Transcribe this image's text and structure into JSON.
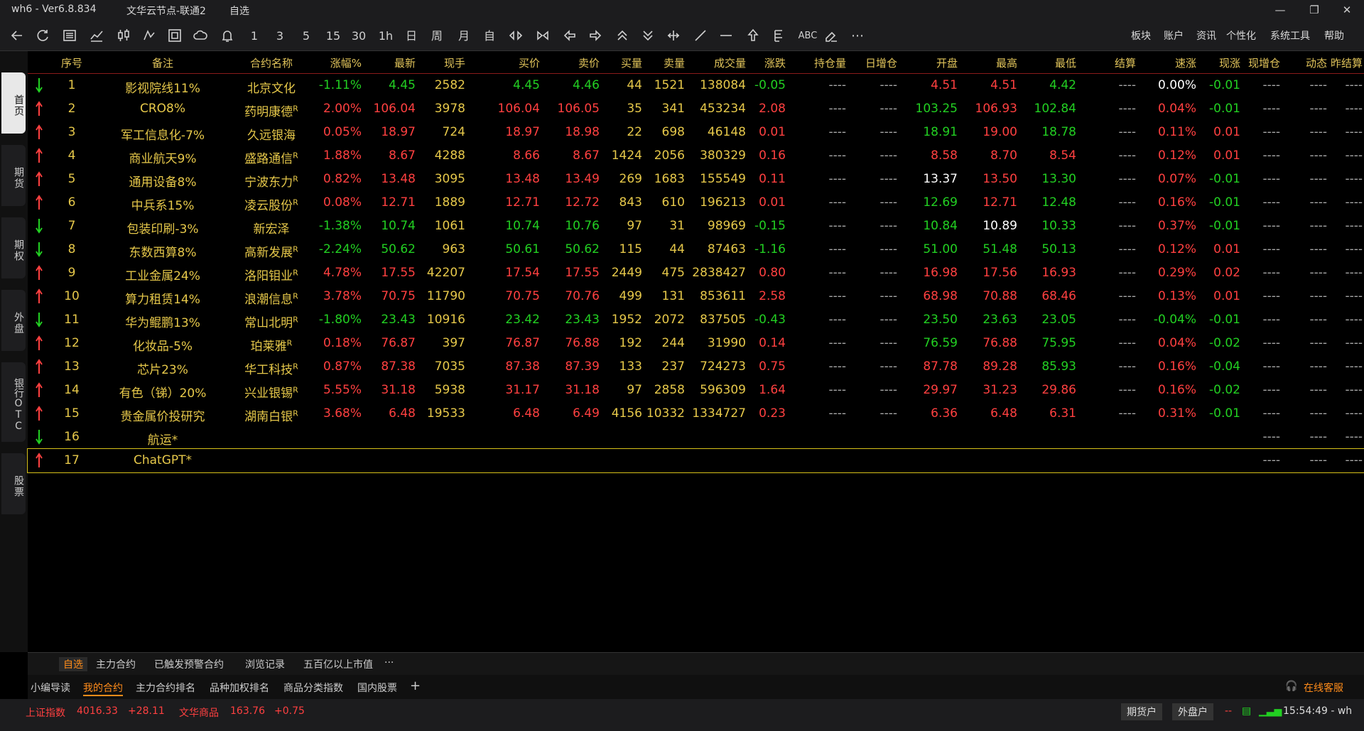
{
  "titlebar": {
    "app": "wh6  -  Ver6.8.834",
    "server": "文华云节点-联通2",
    "view": "自选"
  },
  "toolbar": {
    "buttons": [
      "1",
      "3",
      "5",
      "15",
      "30",
      "1h",
      "日",
      "周",
      "月",
      "自"
    ],
    "menus": [
      "板块",
      "账户",
      "资讯",
      "个性化",
      "系统工具",
      "帮助"
    ],
    "abc": "ABC"
  },
  "sidebar": [
    "首页",
    "期货",
    "期权",
    "外盘",
    "银行OTC",
    "股票"
  ],
  "headers": [
    "序号",
    "备注",
    "合约名称",
    "涨幅%",
    "最新",
    "现手",
    "买价",
    "卖价",
    "买量",
    "卖量",
    "成交量",
    "涨跌",
    "持仓量",
    "日增仓",
    "开盘",
    "最高",
    "最低",
    "结算",
    "速涨",
    "现涨",
    "现增仓",
    "动态",
    "昨结算"
  ],
  "rows": [
    {
      "dir": "down",
      "n": "1",
      "note": "影视院线11%",
      "name": "北京文化",
      "r": "",
      "pct": "-1.11%",
      "last": "4.45",
      "vol1": "2582",
      "bid": "4.45",
      "ask": "4.46",
      "bq": "44",
      "aq": "1521",
      "tot": "138084",
      "chg": "-0.05",
      "oi": "----",
      "doi": "----",
      "open": "4.51",
      "high": "4.51",
      "low": "4.42",
      "settle": "----",
      "speed": "0.00%",
      "cur": "-0.01",
      "cd": "----",
      "dyn": "----",
      "ps": "----",
      "c": {
        "pct": "dn",
        "last": "dn",
        "bid": "dn",
        "ask": "dn",
        "chg": "dn",
        "open": "up",
        "high": "up",
        "low": "dn",
        "speed": "wh",
        "cur": "dn"
      }
    },
    {
      "dir": "up",
      "n": "2",
      "note": "CRO8%",
      "name": "药明康德",
      "r": "R",
      "pct": "2.00%",
      "last": "106.04",
      "vol1": "3978",
      "bid": "106.04",
      "ask": "106.05",
      "bq": "35",
      "aq": "341",
      "tot": "453234",
      "chg": "2.08",
      "oi": "----",
      "doi": "----",
      "open": "103.25",
      "high": "106.93",
      "low": "102.84",
      "settle": "----",
      "speed": "0.04%",
      "cur": "-0.01",
      "cd": "----",
      "dyn": "----",
      "ps": "----",
      "c": {
        "pct": "up",
        "last": "up",
        "bid": "up",
        "ask": "up",
        "chg": "up",
        "open": "dn",
        "high": "up",
        "low": "dn",
        "speed": "up",
        "cur": "dn"
      }
    },
    {
      "dir": "up",
      "n": "3",
      "note": "军工信息化-7%",
      "name": "久远银海",
      "r": "",
      "pct": "0.05%",
      "last": "18.97",
      "vol1": "724",
      "bid": "18.97",
      "ask": "18.98",
      "bq": "22",
      "aq": "698",
      "tot": "46148",
      "chg": "0.01",
      "oi": "----",
      "doi": "----",
      "open": "18.91",
      "high": "19.00",
      "low": "18.78",
      "settle": "----",
      "speed": "0.11%",
      "cur": "0.01",
      "cd": "----",
      "dyn": "----",
      "ps": "----",
      "c": {
        "pct": "up",
        "last": "up",
        "bid": "up",
        "ask": "up",
        "chg": "up",
        "open": "dn",
        "high": "up",
        "low": "dn",
        "speed": "up",
        "cur": "up"
      }
    },
    {
      "dir": "up",
      "n": "4",
      "note": "商业航天9%",
      "name": "盛路通信",
      "r": "R",
      "pct": "1.88%",
      "last": "8.67",
      "vol1": "4288",
      "bid": "8.66",
      "ask": "8.67",
      "bq": "1424",
      "aq": "2056",
      "tot": "380329",
      "chg": "0.16",
      "oi": "----",
      "doi": "----",
      "open": "8.58",
      "high": "8.70",
      "low": "8.54",
      "settle": "----",
      "speed": "0.12%",
      "cur": "0.01",
      "cd": "----",
      "dyn": "----",
      "ps": "----",
      "c": {
        "pct": "up",
        "last": "up",
        "bid": "up",
        "ask": "up",
        "chg": "up",
        "open": "up",
        "high": "up",
        "low": "up",
        "speed": "up",
        "cur": "up"
      }
    },
    {
      "dir": "up",
      "n": "5",
      "note": "通用设备8%",
      "name": "宁波东力",
      "r": "R",
      "pct": "0.82%",
      "last": "13.48",
      "vol1": "3095",
      "bid": "13.48",
      "ask": "13.49",
      "bq": "269",
      "aq": "1683",
      "tot": "155549",
      "chg": "0.11",
      "oi": "----",
      "doi": "----",
      "open": "13.37",
      "high": "13.50",
      "low": "13.30",
      "settle": "----",
      "speed": "0.07%",
      "cur": "-0.01",
      "cd": "----",
      "dyn": "----",
      "ps": "----",
      "c": {
        "pct": "up",
        "last": "up",
        "bid": "up",
        "ask": "up",
        "chg": "up",
        "open": "wh",
        "high": "up",
        "low": "dn",
        "speed": "up",
        "cur": "dn"
      }
    },
    {
      "dir": "up",
      "n": "6",
      "note": "中兵系15%",
      "name": "凌云股份",
      "r": "R",
      "pct": "0.08%",
      "last": "12.71",
      "vol1": "1889",
      "bid": "12.71",
      "ask": "12.72",
      "bq": "843",
      "aq": "610",
      "tot": "196213",
      "chg": "0.01",
      "oi": "----",
      "doi": "----",
      "open": "12.69",
      "high": "12.71",
      "low": "12.48",
      "settle": "----",
      "speed": "0.16%",
      "cur": "-0.01",
      "cd": "----",
      "dyn": "----",
      "ps": "----",
      "c": {
        "pct": "up",
        "last": "up",
        "bid": "up",
        "ask": "up",
        "chg": "up",
        "open": "dn",
        "high": "up",
        "low": "dn",
        "speed": "up",
        "cur": "dn"
      }
    },
    {
      "dir": "down",
      "n": "7",
      "note": "包装印刷-3%",
      "name": "新宏泽",
      "r": "",
      "pct": "-1.38%",
      "last": "10.74",
      "vol1": "1061",
      "bid": "10.74",
      "ask": "10.76",
      "bq": "97",
      "aq": "31",
      "tot": "98969",
      "chg": "-0.15",
      "oi": "----",
      "doi": "----",
      "open": "10.84",
      "high": "10.89",
      "low": "10.33",
      "settle": "----",
      "speed": "0.37%",
      "cur": "-0.01",
      "cd": "----",
      "dyn": "----",
      "ps": "----",
      "c": {
        "pct": "dn",
        "last": "dn",
        "bid": "dn",
        "ask": "dn",
        "chg": "dn",
        "open": "dn",
        "high": "wh",
        "low": "dn",
        "speed": "up",
        "cur": "dn"
      }
    },
    {
      "dir": "down",
      "n": "8",
      "note": "东数西算8%",
      "name": "高新发展",
      "r": "R",
      "pct": "-2.24%",
      "last": "50.62",
      "vol1": "963",
      "bid": "50.61",
      "ask": "50.62",
      "bq": "115",
      "aq": "44",
      "tot": "87463",
      "chg": "-1.16",
      "oi": "----",
      "doi": "----",
      "open": "51.00",
      "high": "51.48",
      "low": "50.13",
      "settle": "----",
      "speed": "0.12%",
      "cur": "0.01",
      "cd": "----",
      "dyn": "----",
      "ps": "----",
      "c": {
        "pct": "dn",
        "last": "dn",
        "bid": "dn",
        "ask": "dn",
        "chg": "dn",
        "open": "dn",
        "high": "dn",
        "low": "dn",
        "speed": "up",
        "cur": "up"
      }
    },
    {
      "dir": "up",
      "n": "9",
      "note": "工业金属24%",
      "name": "洛阳钼业",
      "r": "R",
      "pct": "4.78%",
      "last": "17.55",
      "vol1": "42207",
      "bid": "17.54",
      "ask": "17.55",
      "bq": "2449",
      "aq": "475",
      "tot": "2838427",
      "chg": "0.80",
      "oi": "----",
      "doi": "----",
      "open": "16.98",
      "high": "17.56",
      "low": "16.93",
      "settle": "----",
      "speed": "0.29%",
      "cur": "0.02",
      "cd": "----",
      "dyn": "----",
      "ps": "----",
      "c": {
        "pct": "up",
        "last": "up",
        "bid": "up",
        "ask": "up",
        "chg": "up",
        "open": "up",
        "high": "up",
        "low": "up",
        "speed": "up",
        "cur": "up"
      }
    },
    {
      "dir": "up",
      "n": "10",
      "note": "算力租赁14%",
      "name": "浪潮信息",
      "r": "R",
      "pct": "3.78%",
      "last": "70.75",
      "vol1": "11790",
      "bid": "70.75",
      "ask": "70.76",
      "bq": "499",
      "aq": "131",
      "tot": "853611",
      "chg": "2.58",
      "oi": "----",
      "doi": "----",
      "open": "68.98",
      "high": "70.88",
      "low": "68.46",
      "settle": "----",
      "speed": "0.13%",
      "cur": "0.01",
      "cd": "----",
      "dyn": "----",
      "ps": "----",
      "c": {
        "pct": "up",
        "last": "up",
        "bid": "up",
        "ask": "up",
        "chg": "up",
        "open": "up",
        "high": "up",
        "low": "up",
        "speed": "up",
        "cur": "up"
      }
    },
    {
      "dir": "down",
      "n": "11",
      "note": "华为鲲鹏13%",
      "name": "常山北明",
      "r": "R",
      "pct": "-1.80%",
      "last": "23.43",
      "vol1": "10916",
      "bid": "23.42",
      "ask": "23.43",
      "bq": "1952",
      "aq": "2072",
      "tot": "837505",
      "chg": "-0.43",
      "oi": "----",
      "doi": "----",
      "open": "23.50",
      "high": "23.63",
      "low": "23.05",
      "settle": "----",
      "speed": "-0.04%",
      "cur": "-0.01",
      "cd": "----",
      "dyn": "----",
      "ps": "----",
      "c": {
        "pct": "dn",
        "last": "dn",
        "bid": "dn",
        "ask": "dn",
        "chg": "dn",
        "open": "dn",
        "high": "dn",
        "low": "dn",
        "speed": "dn",
        "cur": "dn"
      }
    },
    {
      "dir": "up",
      "n": "12",
      "note": "化妆品-5%",
      "name": "珀莱雅",
      "r": "R",
      "pct": "0.18%",
      "last": "76.87",
      "vol1": "397",
      "bid": "76.87",
      "ask": "76.88",
      "bq": "192",
      "aq": "244",
      "tot": "31990",
      "chg": "0.14",
      "oi": "----",
      "doi": "----",
      "open": "76.59",
      "high": "76.88",
      "low": "75.95",
      "settle": "----",
      "speed": "0.04%",
      "cur": "-0.02",
      "cd": "----",
      "dyn": "----",
      "ps": "----",
      "c": {
        "pct": "up",
        "last": "up",
        "bid": "up",
        "ask": "up",
        "chg": "up",
        "open": "dn",
        "high": "up",
        "low": "dn",
        "speed": "up",
        "cur": "dn"
      }
    },
    {
      "dir": "up",
      "n": "13",
      "note": "芯片23%",
      "name": "华工科技",
      "r": "R",
      "pct": "0.87%",
      "last": "87.38",
      "vol1": "7035",
      "bid": "87.38",
      "ask": "87.39",
      "bq": "133",
      "aq": "237",
      "tot": "724273",
      "chg": "0.75",
      "oi": "----",
      "doi": "----",
      "open": "87.78",
      "high": "89.28",
      "low": "85.93",
      "settle": "----",
      "speed": "0.16%",
      "cur": "-0.04",
      "cd": "----",
      "dyn": "----",
      "ps": "----",
      "c": {
        "pct": "up",
        "last": "up",
        "bid": "up",
        "ask": "up",
        "chg": "up",
        "open": "up",
        "high": "up",
        "low": "dn",
        "speed": "up",
        "cur": "dn"
      }
    },
    {
      "dir": "up",
      "n": "14",
      "note": "有色（锑）20%",
      "name": "兴业银锡",
      "r": "R",
      "pct": "5.55%",
      "last": "31.18",
      "vol1": "5938",
      "bid": "31.17",
      "ask": "31.18",
      "bq": "97",
      "aq": "2858",
      "tot": "596309",
      "chg": "1.64",
      "oi": "----",
      "doi": "----",
      "open": "29.97",
      "high": "31.23",
      "low": "29.86",
      "settle": "----",
      "speed": "0.16%",
      "cur": "-0.02",
      "cd": "----",
      "dyn": "----",
      "ps": "----",
      "c": {
        "pct": "up",
        "last": "up",
        "bid": "up",
        "ask": "up",
        "chg": "up",
        "open": "up",
        "high": "up",
        "low": "up",
        "speed": "up",
        "cur": "dn"
      }
    },
    {
      "dir": "up",
      "n": "15",
      "note": "贵金属价投研究",
      "name": "湖南白银",
      "r": "R",
      "pct": "3.68%",
      "last": "6.48",
      "vol1": "19533",
      "bid": "6.48",
      "ask": "6.49",
      "bq": "4156",
      "aq": "10332",
      "tot": "1334727",
      "chg": "0.23",
      "oi": "----",
      "doi": "----",
      "open": "6.36",
      "high": "6.48",
      "low": "6.31",
      "settle": "----",
      "speed": "0.31%",
      "cur": "-0.01",
      "cd": "----",
      "dyn": "----",
      "ps": "----",
      "c": {
        "pct": "up",
        "last": "up",
        "bid": "up",
        "ask": "up",
        "chg": "up",
        "open": "up",
        "high": "up",
        "low": "up",
        "speed": "up",
        "cur": "dn"
      }
    },
    {
      "dir": "down",
      "n": "16",
      "note": "航运*",
      "name": "",
      "r": "",
      "pct": "",
      "last": "",
      "vol1": "",
      "bid": "",
      "ask": "",
      "bq": "",
      "aq": "",
      "tot": "",
      "chg": "",
      "oi": "",
      "doi": "",
      "open": "",
      "high": "",
      "low": "",
      "settle": "",
      "speed": "",
      "cur": "",
      "cd": "----",
      "dyn": "----",
      "ps": "----",
      "c": {}
    },
    {
      "dir": "up",
      "n": "17",
      "note": "ChatGPT*",
      "name": "",
      "r": "",
      "pct": "",
      "last": "",
      "vol1": "",
      "bid": "",
      "ask": "",
      "bq": "",
      "aq": "",
      "tot": "",
      "chg": "",
      "oi": "",
      "doi": "",
      "open": "",
      "high": "",
      "low": "",
      "settle": "",
      "speed": "",
      "cur": "",
      "cd": "----",
      "dyn": "----",
      "ps": "----",
      "c": {}
    }
  ],
  "tabs1": [
    "自选",
    "主力合约",
    "已触发预警合约",
    "浏览记录",
    "五百亿以上市值",
    "···"
  ],
  "tabs2": [
    "小编导读",
    "我的合约",
    "主力合约排名",
    "品种加权排名",
    "商品分类指数",
    "国内股票",
    "+"
  ],
  "service": "在线客服",
  "status": {
    "idx1_name": "上证指数",
    "idx1_val": "4016.33",
    "idx1_chg": "+28.11",
    "idx2_name": "文华商品",
    "idx2_val": "163.76",
    "idx2_chg": "+0.75",
    "btn1": "期货户",
    "btn2": "外盘户",
    "dash": "--",
    "time": "15:54:49 - wh"
  },
  "colors": {
    "up": "#ff4040",
    "down": "#22d022",
    "header": "#e0c35a",
    "accent": "#ff8c1a"
  }
}
